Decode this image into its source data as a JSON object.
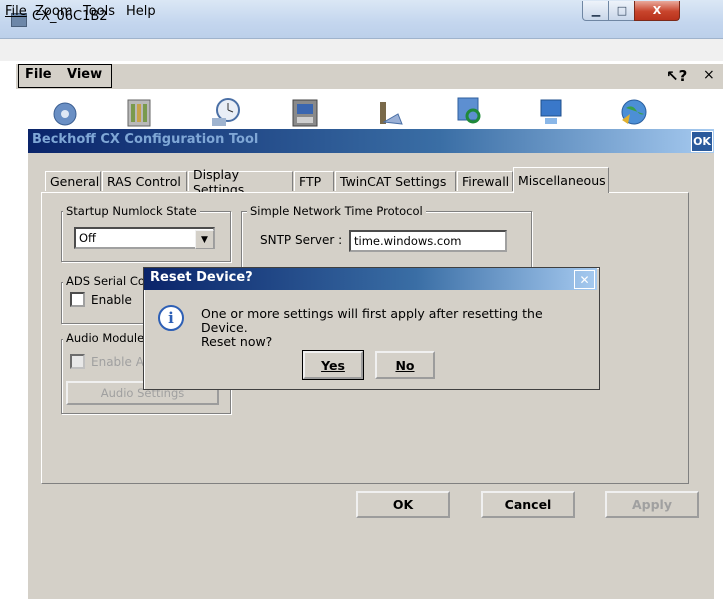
{
  "window": {
    "title": "CX_06C1B2"
  },
  "menubar": {
    "file": "File",
    "zoom": "Zoom",
    "tools": "Tools",
    "help": "Help"
  },
  "ce_toolbar": {
    "file": "File",
    "view": "View",
    "help_icon": "↖?",
    "close": "×"
  },
  "dialog": {
    "title": "Beckhoff CX Configuration Tool",
    "ok_corner": "OK",
    "tabs": [
      "General",
      "RAS Control",
      "Display Settings",
      "FTP",
      "TwinCAT Settings",
      "Firewall",
      "Miscellaneous"
    ],
    "active_tab": "Miscellaneous",
    "numlock": {
      "label": "Startup Numlock State",
      "value": "Off"
    },
    "sntp": {
      "label": "Simple Network Time Protocol",
      "server_label": "SNTP Server :",
      "server_value": "time.windows.com"
    },
    "ads": {
      "label": "ADS Serial Con",
      "enable_label": "Enable"
    },
    "audio": {
      "label": "Audio Module",
      "enable_label": "Enable Au",
      "settings_button": "Audio Settings"
    },
    "buttons": {
      "ok": "OK",
      "cancel": "Cancel",
      "apply": "Apply"
    }
  },
  "reset_dialog": {
    "title": "Reset Device?",
    "message_line1": "One or more settings will first apply after resetting the Device.",
    "message_line2": "Reset now?",
    "yes": "Yes",
    "no": "No"
  }
}
